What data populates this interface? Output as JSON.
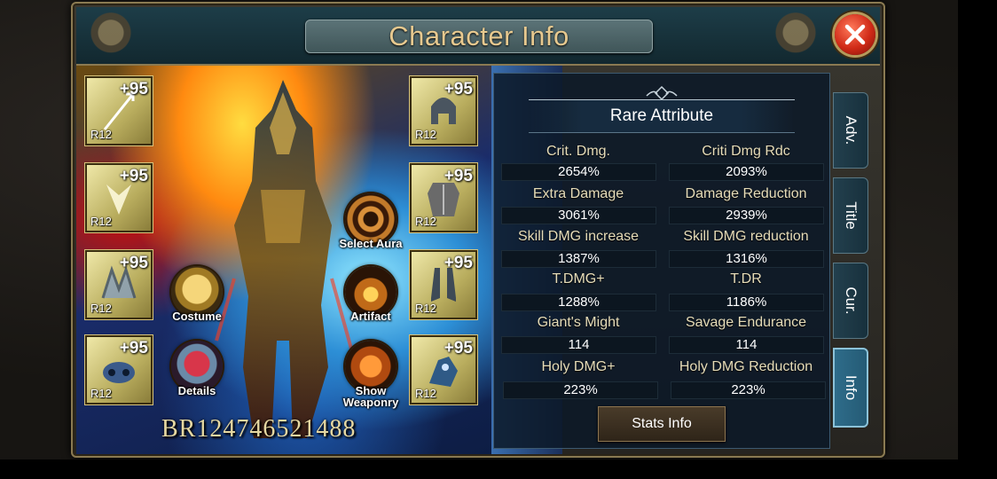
{
  "window": {
    "title": "Character Info"
  },
  "equipment": {
    "left": [
      {
        "plus": "+95",
        "rank": "R12",
        "icon": "spear-icon"
      },
      {
        "plus": "+95",
        "rank": "R12",
        "icon": "wings-icon"
      },
      {
        "plus": "+95",
        "rank": "R12",
        "icon": "wings-icon"
      },
      {
        "plus": "+95",
        "rank": "R12",
        "icon": "mask-icon"
      }
    ],
    "right": [
      {
        "plus": "+95",
        "rank": "R12",
        "icon": "helmet-icon"
      },
      {
        "plus": "+95",
        "rank": "R12",
        "icon": "armor-icon"
      },
      {
        "plus": "+95",
        "rank": "R12",
        "icon": "boots-icon"
      },
      {
        "plus": "+95",
        "rank": "R12",
        "icon": "mount-icon"
      }
    ]
  },
  "buttons": {
    "costume": "Costume",
    "details": "Details",
    "select_aura": "Select Aura",
    "artifact": "Artifact",
    "show_weaponry_line1": "Show",
    "show_weaponry_line2": "Weaponry"
  },
  "battle_rating": "BR124746521488",
  "rare_attribute": {
    "title": "Rare Attribute",
    "stats": [
      {
        "label": "Crit. Dmg.",
        "value": "2654%"
      },
      {
        "label": "Criti Dmg Rdc",
        "value": "2093%"
      },
      {
        "label": "Extra Damage",
        "value": "3061%"
      },
      {
        "label": "Damage Reduction",
        "value": "2939%"
      },
      {
        "label": "Skill DMG increase",
        "value": "1387%"
      },
      {
        "label": "Skill DMG reduction",
        "value": "1316%"
      },
      {
        "label": "T.DMG+",
        "value": "1288%"
      },
      {
        "label": "T.DR",
        "value": "1186%"
      },
      {
        "label": "Giant's Might",
        "value": "114"
      },
      {
        "label": "Savage Endurance",
        "value": "114"
      },
      {
        "label": "Holy DMG+",
        "value": "223%"
      },
      {
        "label": "Holy DMG Reduction",
        "value": "223%"
      }
    ],
    "stats_info_button": "Stats Info"
  },
  "side_tabs": [
    {
      "label": "Adv.",
      "active": false
    },
    {
      "label": "Title",
      "active": false
    },
    {
      "label": "Cur.",
      "active": false
    },
    {
      "label": "Info",
      "active": true
    }
  ],
  "colors": {
    "title_text": "#e7c98f",
    "slot_gold": "#d7c27a",
    "close_red": "#d02a17",
    "active_tab": "#2f6d8b"
  }
}
